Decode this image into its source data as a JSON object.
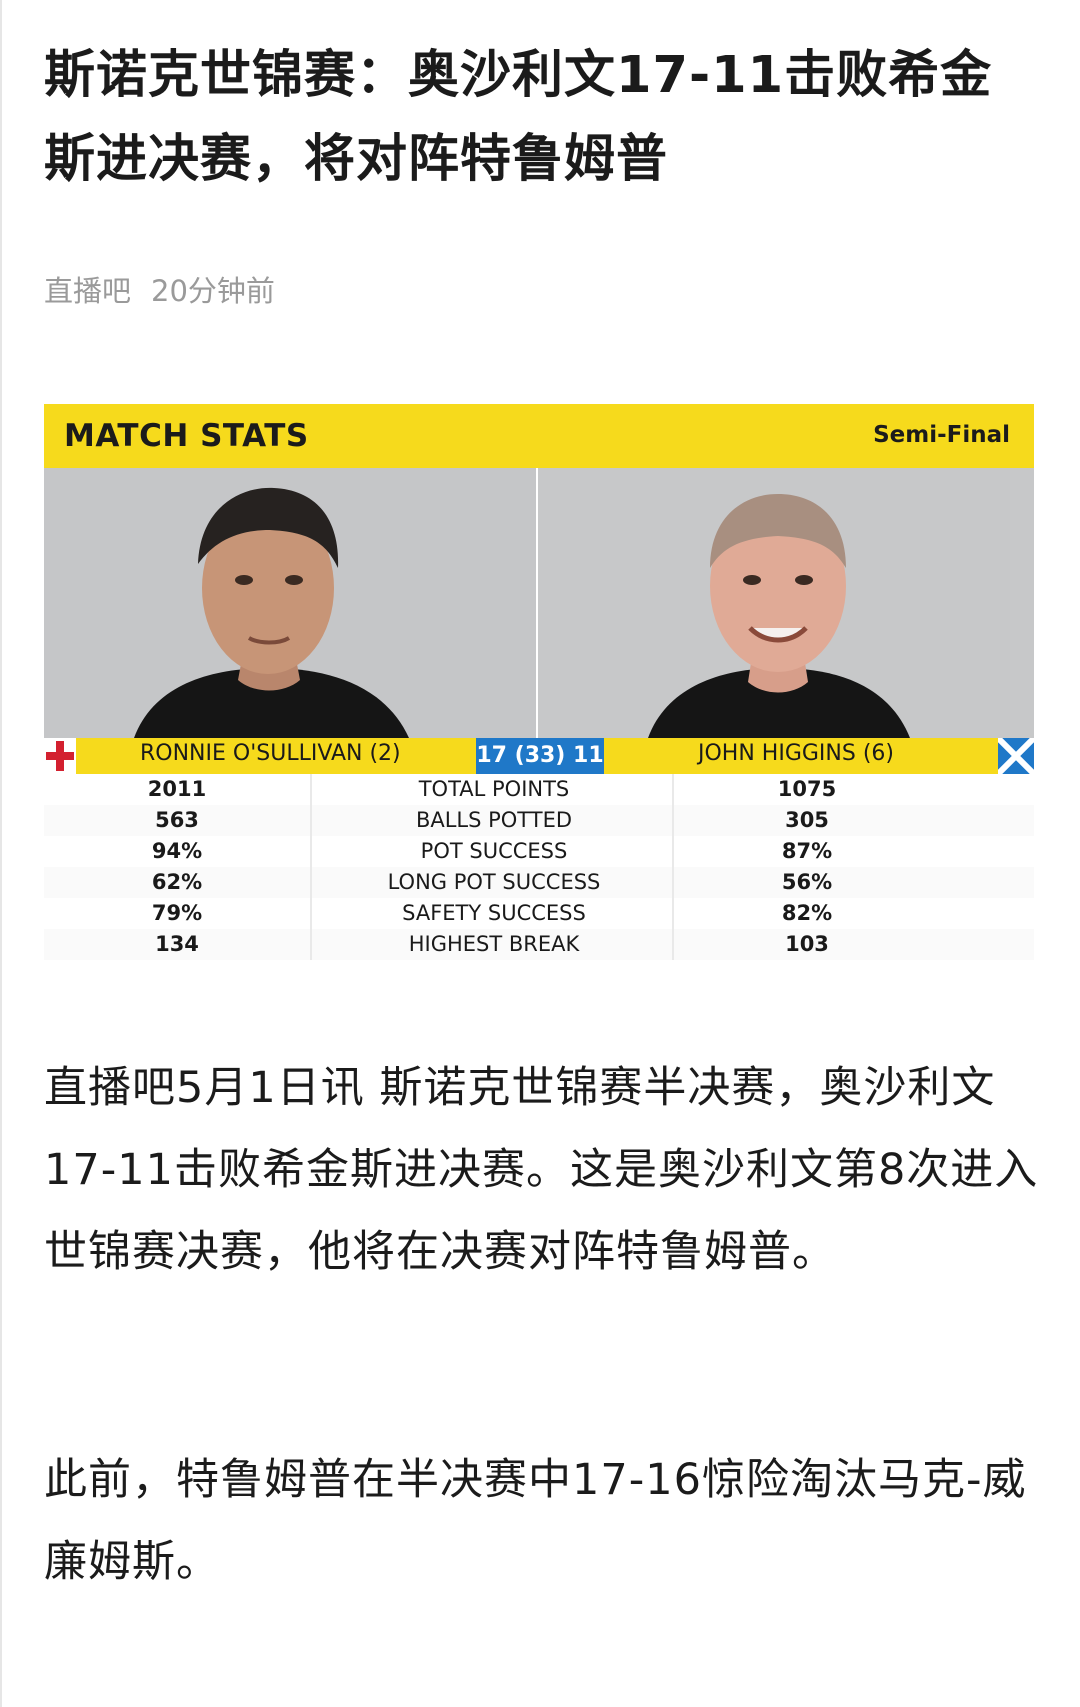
{
  "article": {
    "title": "斯诺克世锦赛：奥沙利文17-11击败希金斯进决赛，将对阵特鲁姆普",
    "source": "直播吧",
    "time": "20分钟前",
    "paragraphs": [
      "直播吧5月1日讯 斯诺克世锦赛半决赛，奥沙利文17-11击败希金斯进决赛。这是奥沙利文第8次进入世锦赛决赛，他将在决赛对阵特鲁姆普。",
      "此前，特鲁姆普在半决赛中17-16惊险淘汰马克-威廉姆斯。"
    ]
  },
  "stats_card": {
    "title": "MATCH STATS",
    "round": "Semi-Final",
    "player_left": "RONNIE O'SULLIVAN (2)",
    "player_right": "JOHN HIGGINS (6)",
    "score": "17 (33) 11",
    "flag_left": "england-flag-icon",
    "flag_right": "scotland-flag-icon",
    "rows": [
      {
        "left": "2011",
        "label": "TOTAL POINTS",
        "right": "1075"
      },
      {
        "left": "563",
        "label": "BALLS POTTED",
        "right": "305"
      },
      {
        "left": "94%",
        "label": "POT SUCCESS",
        "right": "87%"
      },
      {
        "left": "62%",
        "label": "LONG POT SUCCESS",
        "right": "56%"
      },
      {
        "left": "79%",
        "label": "SAFETY SUCCESS",
        "right": "82%"
      },
      {
        "left": "134",
        "label": "HIGHEST BREAK",
        "right": "103"
      }
    ],
    "colors": {
      "header": "#f6da1c",
      "score_box": "#1f78c8",
      "photo_bg": "#c7c8c9"
    }
  }
}
